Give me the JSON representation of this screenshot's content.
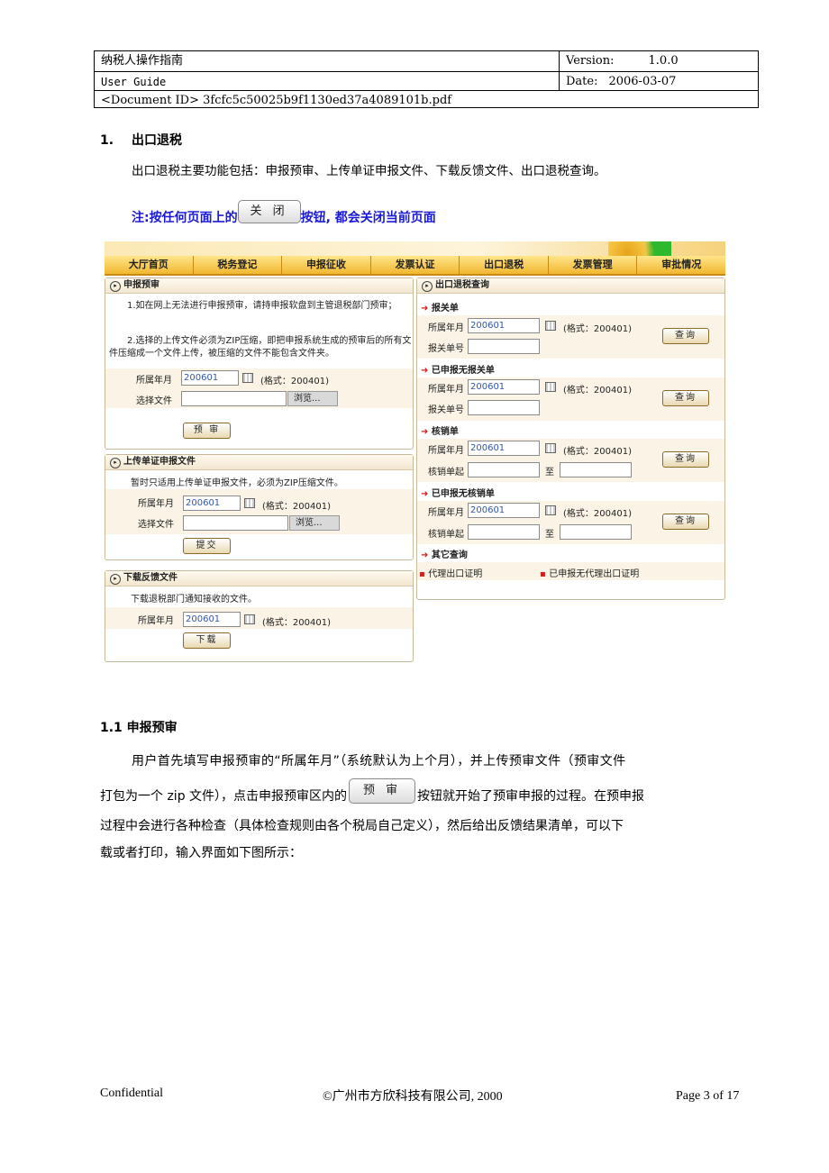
{
  "header": {
    "title_cn": "纳税人操作指南",
    "title_en": "User Guide",
    "doc_id": "<Document ID> 3fcfc5c50025b9f1130ed37a4089101b.pdf",
    "version_label": "Version:",
    "version_value": "1.0.0",
    "date_label": "Date:",
    "date_value": "2006-03-07"
  },
  "section1": {
    "number": "1.",
    "title": "出口退税",
    "intro": "出口退税主要功能包括：申报预审、上传单证申报文件、下载反馈文件、出口退税查询。",
    "note_before": "注:按任何页面上的",
    "note_button": "关 闭",
    "note_after": "按钮, 都会关闭当前页面"
  },
  "screenshot": {
    "nav": [
      "大厅首页",
      "税务登记",
      "申报征收",
      "发票认证",
      "出口退税",
      "发票管理",
      "审批情况"
    ],
    "prereview": {
      "title": "申报预审",
      "note1": "1.如在网上无法进行申报预审，请持申报软盘到主管退税部门预审；",
      "note2": "2.选择的上传文件必须为ZIP压缩，即把申报系统生成的预审后的所有文件压缩成一个文件上传，被压缩的文件不能包含文件夹。",
      "month_label": "所属年月",
      "month_value": "200601",
      "format_hint": "(格式：200401)",
      "file_label": "选择文件",
      "browse": "浏览...",
      "button": "预 审"
    },
    "upload": {
      "title": "上传单证申报文件",
      "note": "暂时只适用上传单证申报文件，必须为ZIP压缩文件。",
      "month_label": "所属年月",
      "month_value": "200601",
      "format_hint": "(格式：200401)",
      "file_label": "选择文件",
      "browse": "浏览...",
      "button": "提交"
    },
    "download": {
      "title": "下载反馈文件",
      "note": "下载退税部门通知接收的文件。",
      "month_label": "所属年月",
      "month_value": "200601",
      "format_hint": "(格式：200401)",
      "button": "下载"
    },
    "query": {
      "title": "出口退税查询",
      "sections": [
        {
          "heading": "报关单",
          "month_label": "所属年月",
          "month_value": "200601",
          "format_hint": "(格式：200401)",
          "second_label": "报关单号",
          "range": false,
          "button": "查询"
        },
        {
          "heading": "已申报无报关单",
          "month_label": "所属年月",
          "month_value": "200601",
          "format_hint": "(格式：200401)",
          "second_label": "报关单号",
          "range": false,
          "button": "查询"
        },
        {
          "heading": "核销单",
          "month_label": "所属年月",
          "month_value": "200601",
          "format_hint": "(格式：200401)",
          "second_label": "核销单起",
          "range": true,
          "range_to": "至",
          "button": "查询"
        },
        {
          "heading": "已申报无核销单",
          "month_label": "所属年月",
          "month_value": "200601",
          "format_hint": "(格式：200401)",
          "second_label": "核销单起",
          "range": true,
          "range_to": "至",
          "button": "查询"
        }
      ],
      "other_heading": "其它查询",
      "other_links": [
        "代理出口证明",
        "已申报无代理出口证明"
      ]
    }
  },
  "section11": {
    "title": "1.1 申报预审",
    "p1": "用户首先填写申报预审的“所属年月”（系统默认为上个月），并上传预审文件（预审文件",
    "p2_before": "打包为一个 zip 文件），点击申报预审区内的",
    "p2_button": "预 审",
    "p2_after": "按钮就开始了预审申报的过程。在预申报",
    "p3": "过程中会进行各种检查（具体检查规则由各个税局自己定义），然后给出反馈结果清单，可以下",
    "p4": "载或者打印，输入界面如下图所示："
  },
  "footer": {
    "left": "Confidential",
    "center": "©广州市方欣科技有限公司, 2000",
    "right": "Page 3 of 17"
  }
}
